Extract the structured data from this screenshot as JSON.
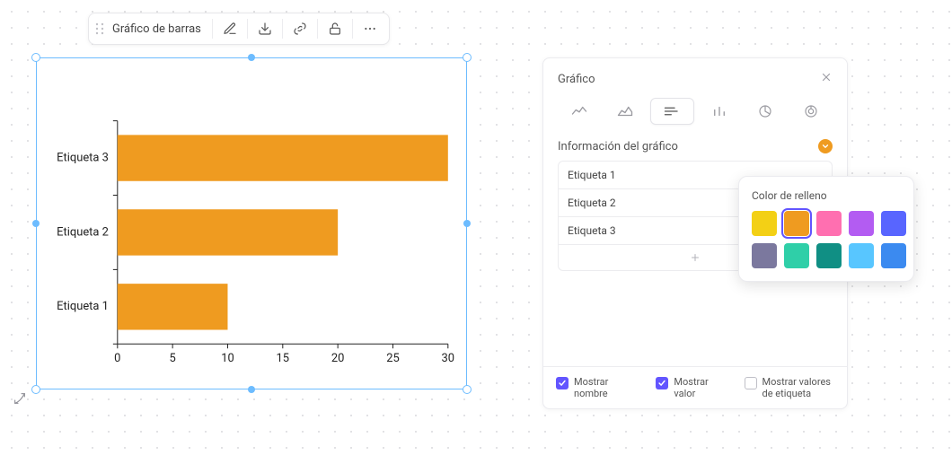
{
  "toolbar": {
    "title": "Gráfico de barras"
  },
  "chart_data": {
    "type": "bar",
    "orientation": "horizontal",
    "categories": [
      "Etiqueta 3",
      "Etiqueta 2",
      "Etiqueta 1"
    ],
    "values": [
      30,
      20,
      10
    ],
    "title": "",
    "xlabel": "",
    "ylabel": "",
    "xlim": [
      0,
      30
    ],
    "x_ticks": [
      0,
      5,
      10,
      15,
      20,
      25,
      30
    ],
    "fill": "#ef9b20"
  },
  "panel": {
    "title": "Gráfico",
    "section_info": "Información del gráfico",
    "rows": [
      "Etiqueta 1",
      "Etiqueta 2",
      "Etiqueta 3"
    ],
    "show_name_label": "Mostrar nombre",
    "show_value_label": "Mostrar valor",
    "show_tag_values_label": "Mostrar valores de etiqueta",
    "show_name": true,
    "show_value": true,
    "show_tag_values": false
  },
  "popover": {
    "title": "Color de relleno",
    "swatches": [
      "#f3d015",
      "#ef9b20",
      "#ff6fb0",
      "#b35cf2",
      "#5865ff",
      "#7b789e",
      "#2fcfa8",
      "#108f84",
      "#58c6ff",
      "#3b8af0"
    ],
    "selected": 1
  }
}
